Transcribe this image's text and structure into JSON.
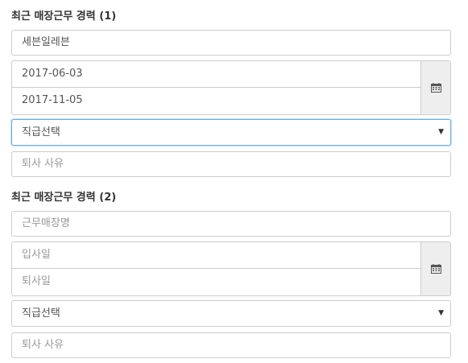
{
  "career1": {
    "title": "최근 매장근무 경력 (1)",
    "store_value": "세븐일레븐",
    "start_date": "2017-06-03",
    "end_date": "2017-11-05",
    "position_select": "직급선택",
    "leave_reason_placeholder": "퇴사 사유"
  },
  "career2": {
    "title": "최근 매장근무 경력 (2)",
    "store_placeholder": "근무매장명",
    "start_placeholder": "입사일",
    "end_placeholder": "퇴사일",
    "position_select": "직급선택",
    "leave_reason_placeholder": "퇴사 사유"
  },
  "icons": {
    "calendar": "calendar-icon",
    "dropdown": "triangle-down"
  },
  "colors": {
    "focus_border": "#66afe9",
    "border": "#cccccc",
    "addon_bg": "#eeeeee",
    "placeholder": "#999999"
  }
}
